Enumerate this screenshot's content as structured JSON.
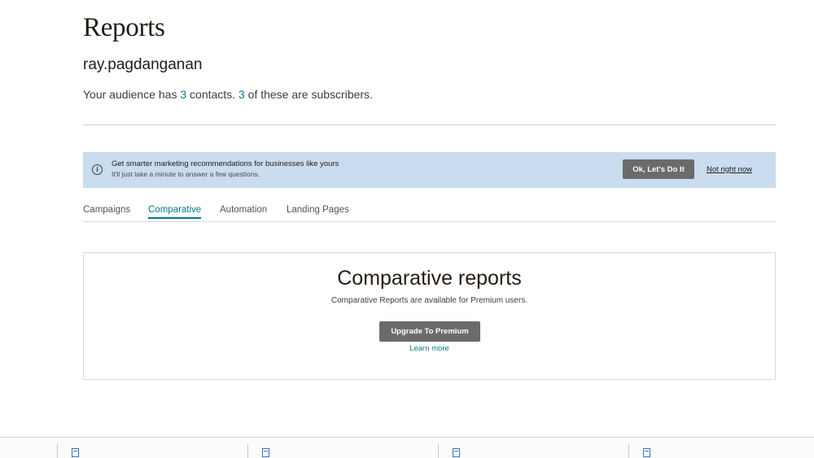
{
  "header": {
    "title": "Reports",
    "account": "ray.pagdanganan",
    "summary_prefix": "Your audience has ",
    "contacts_count": "3",
    "summary_middle": " contacts. ",
    "subscribers_count": "3",
    "summary_suffix": " of these are subscribers."
  },
  "banner": {
    "heading": "Get smarter marketing recommendations for businesses like yours",
    "subtext": "It'll just take a minute to answer a few questions.",
    "ok_label": "Ok, Let's Do It",
    "dismiss_label": "Not right now",
    "info_icon": "info-circle-icon",
    "background": "#c9dcf0"
  },
  "tabs": [
    {
      "label": "Campaigns",
      "active": false
    },
    {
      "label": "Comparative",
      "active": true
    },
    {
      "label": "Automation",
      "active": false
    },
    {
      "label": "Landing Pages",
      "active": false
    }
  ],
  "card": {
    "title": "Comparative reports",
    "text": "Comparative Reports are available for Premium users.",
    "button_label": "Upgrade To Premium",
    "link_label": "Learn more"
  },
  "colors": {
    "accent": "#007c89",
    "button": "#6b6b6b",
    "text": "#241c15"
  },
  "taskbar": {
    "items": [
      {
        "icon": "document-icon"
      },
      {
        "icon": "document-icon"
      },
      {
        "icon": "document-icon"
      },
      {
        "icon": "document-icon"
      }
    ]
  }
}
